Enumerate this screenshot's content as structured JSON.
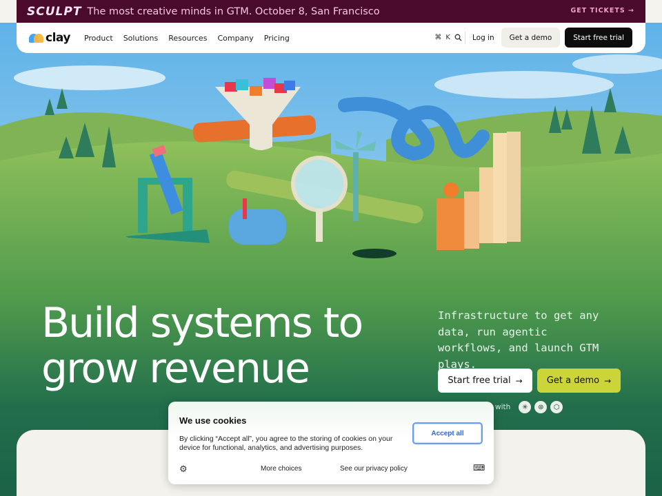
{
  "banner": {
    "logo": "SCULPT",
    "message": "The most creative minds in GTM. October 8, San Francisco",
    "cta": "GET TICKETS →"
  },
  "nav": {
    "brand": "clay",
    "menu": [
      "Product",
      "Solutions",
      "Resources",
      "Company",
      "Pricing"
    ],
    "shortcut_symbol": "⌘",
    "shortcut_key": "K",
    "search_icon": "search-icon",
    "login": "Log in",
    "demo": "Get a demo",
    "trial": "Start free trial"
  },
  "hero": {
    "headline_line1": "Build systems to",
    "headline_line2": "grow revenue",
    "subhead": "Infrastructure to get any data, run agentic workflows, and launch GTM plays.",
    "cta_trial": "Start free trial",
    "cta_demo": "Get a demo",
    "arrow": "→",
    "partners_text": "with",
    "partner_icons": [
      "✳",
      "⊛",
      "⬡"
    ]
  },
  "cookie": {
    "title": "We use cookies",
    "body": "By clicking “Accept all”, you agree to the storing of cookies on your device for functional, analytics, and advertising purposes.",
    "accept": "Accept all",
    "more": "More choices",
    "privacy": "See our privacy policy",
    "settings_icon": "gear-icon",
    "language_icon": "translate-icon"
  },
  "colors": {
    "banner_bg": "#4a0a2c",
    "hero_green": "#1f6a4b",
    "demo_accent": "#cbd53a",
    "accept_blue": "#2f64e0"
  }
}
